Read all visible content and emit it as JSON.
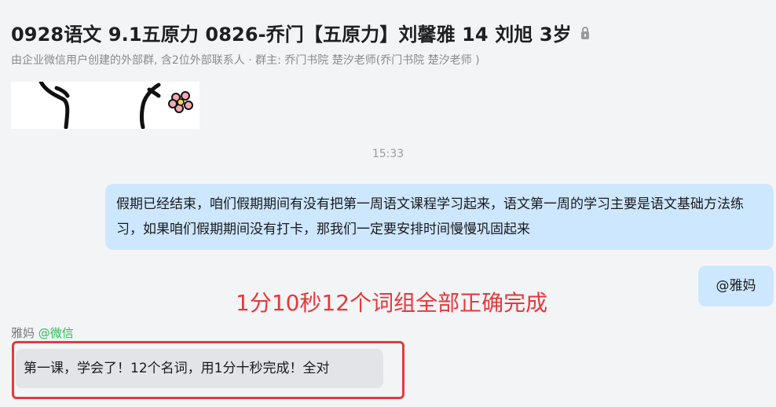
{
  "header": {
    "title": "0928语文 9.1五原力  0826-乔门【五原力】刘馨雅 14 刘旭 3岁",
    "subtitle": "由企业微信用户创建的外部群, 含2位外部联系人 · 群主: 乔门书院 楚汐老师(乔门书院 楚汐老师 )",
    "title_icon": "lock-icon"
  },
  "messages": {
    "timestamp": "15:33",
    "outgoing_1": "假期已经结束，咱们假期期间有没有把第一周语文课程学习起来，语文第一周的学习主要是语文基础方法练习，如果咱们假期期间没有打卡，那我们一定要安排时间慢慢巩固起来",
    "outgoing_2": "@雅妈",
    "sender_name": "雅妈",
    "sender_source": "@微信",
    "incoming_1": "第一课，学会了！12个名词，用1分十秒完成！全对"
  },
  "annotation": {
    "text": "1分10秒12个词组全部正确完成",
    "color": "#e4393c"
  },
  "colors": {
    "outgoing_bubble": "#cde7ff",
    "incoming_bubble": "#e2e4e8",
    "highlight": "#e23c3c",
    "source_tag": "#2dbb55"
  }
}
